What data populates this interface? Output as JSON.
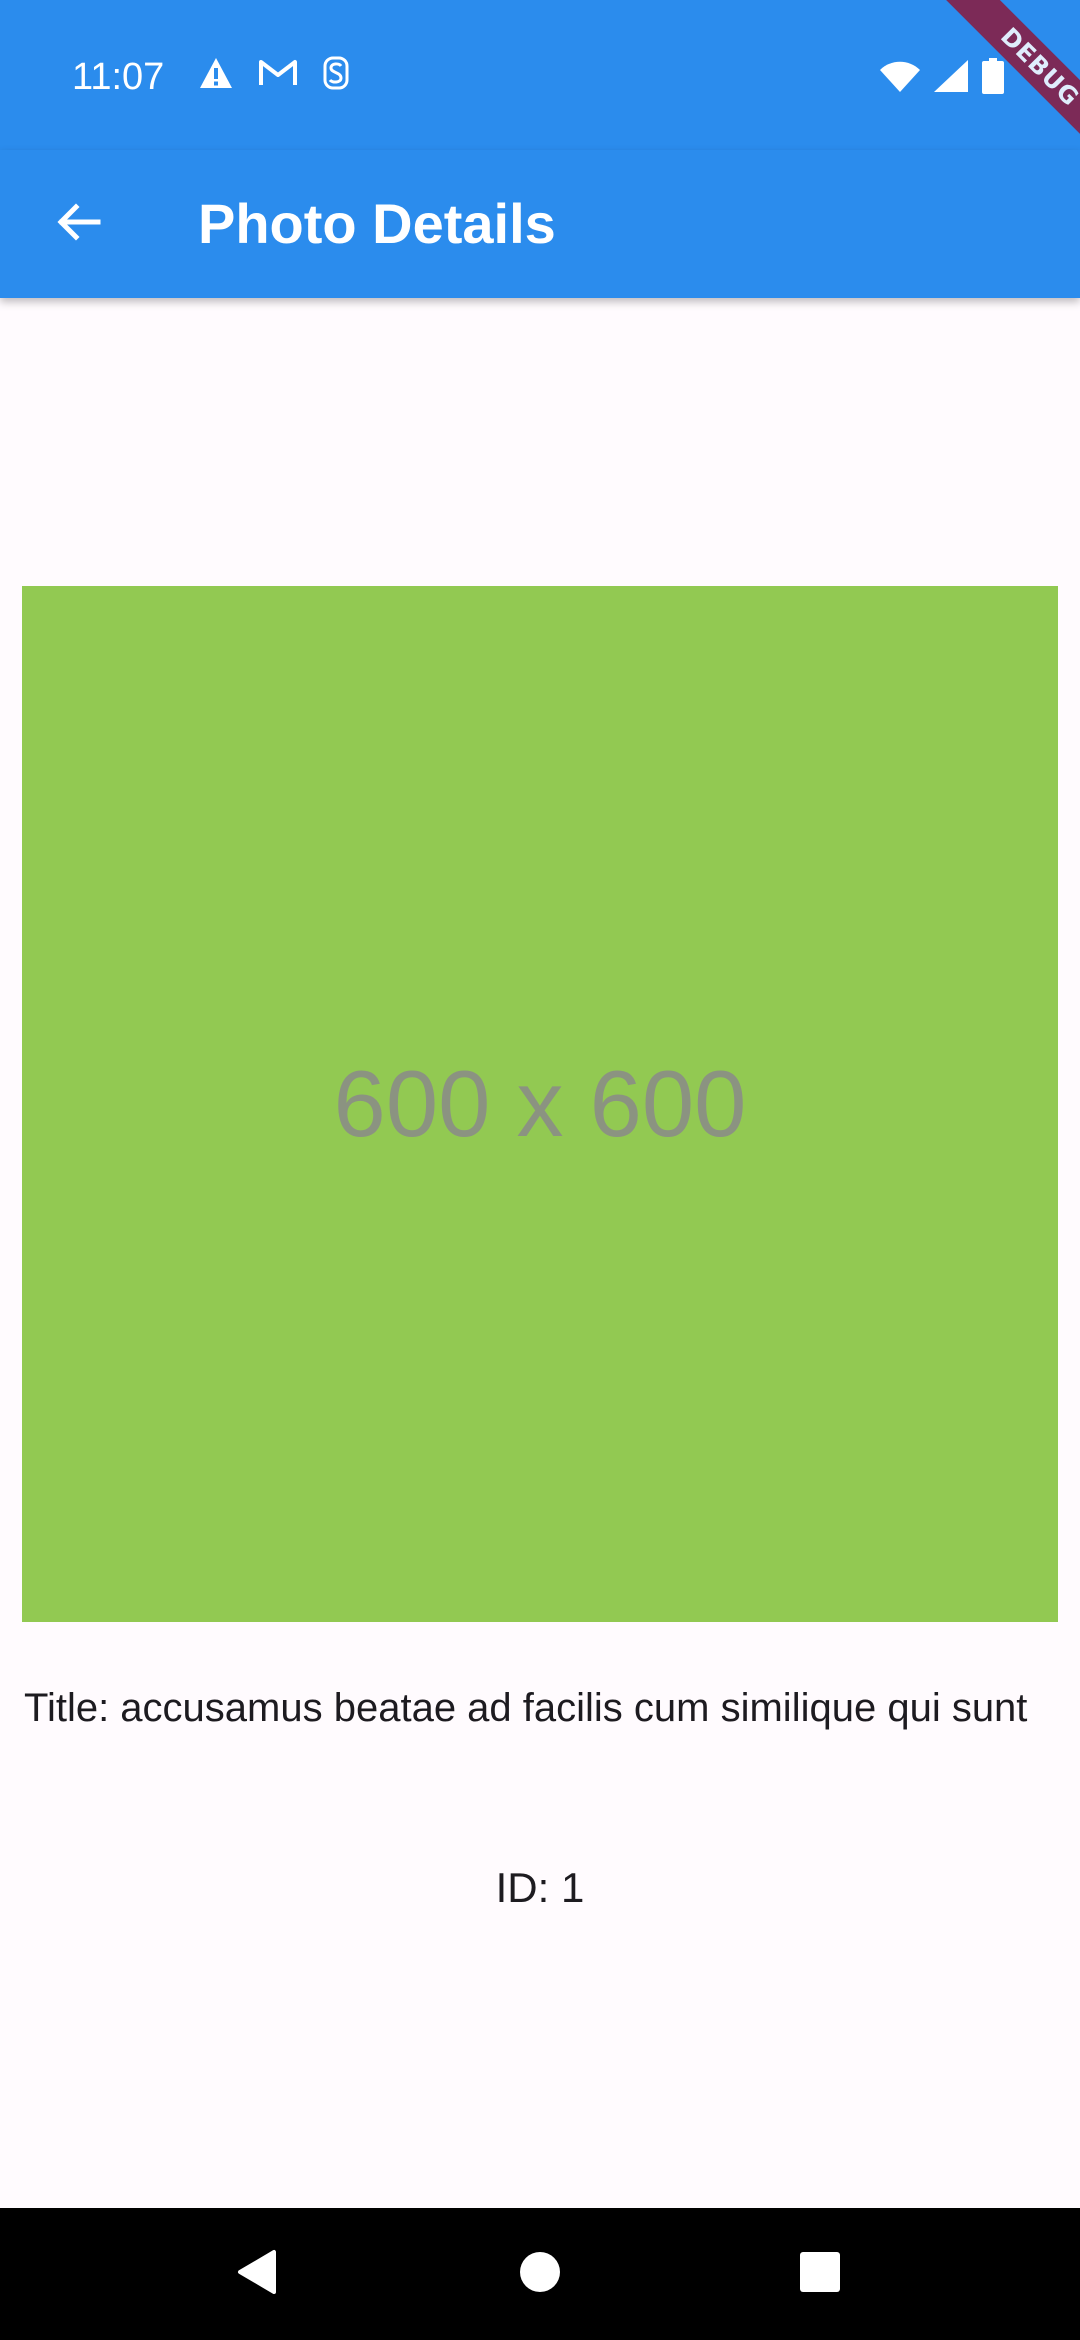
{
  "status_bar": {
    "time": "11:07",
    "left_icons": [
      "warning-icon",
      "gmail-icon",
      "s-notification-icon"
    ],
    "right_icons": [
      "wifi-icon",
      "cell-signal-icon",
      "battery-icon"
    ],
    "background_color": "#2b8ced"
  },
  "debug_banner": {
    "label": "DEBUG",
    "color": "#8b1a3e"
  },
  "app_bar": {
    "title": "Photo Details",
    "back_icon": "arrow-back-icon",
    "background_color": "#2b8ced"
  },
  "photo": {
    "placeholder_text": "600 x 600",
    "background_color": "#92c952"
  },
  "details": {
    "title_text": "Title: accusamus beatae ad facilis cum similique qui sunt",
    "id_text": "ID: 1"
  },
  "nav_bar": {
    "buttons": [
      "back-triangle-icon",
      "home-circle-icon",
      "recents-square-icon"
    ]
  }
}
